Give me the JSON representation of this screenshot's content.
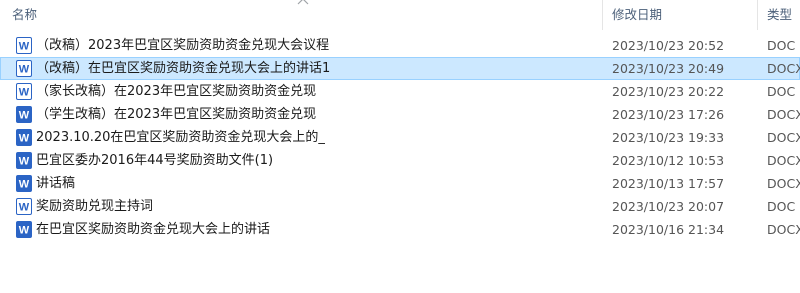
{
  "columns": {
    "name": "名称",
    "date_modified": "修改日期",
    "type": "类型"
  },
  "sort_icon": "chevron-up-icon",
  "colors": {
    "selected_row_bg": "#cce8ff",
    "selected_row_border": "#99d1ff",
    "word_blue": "#2b64c5",
    "header_text": "#4c607a"
  },
  "files": [
    {
      "name": " （改稿）2023年巴宜区奖励资助资金兑现大会议程",
      "date": "2023/10/23 20:52",
      "type": "DOC",
      "icon": "word-doc-icon",
      "selected": false
    },
    {
      "name": " （改稿）在巴宜区奖励资助资金兑现大会上的讲话1",
      "date": "2023/10/23 20:49",
      "type": "DOCX",
      "icon": "word-doc-icon",
      "selected": true
    },
    {
      "name": " （家长改稿）在2023年巴宜区奖励资助资金兑现",
      "date": "2023/10/23 20:22",
      "type": "DOC",
      "icon": "word-doc-icon",
      "selected": false
    },
    {
      "name": " （学生改稿）在2023年巴宜区奖励资助资金兑现",
      "date": "2023/10/23 17:26",
      "type": "DOCX",
      "icon": "word-docx-icon",
      "selected": false
    },
    {
      "name": "2023.10.20在巴宜区奖励资助资金兑现大会上的_",
      "date": "2023/10/23 19:33",
      "type": "DOCX",
      "icon": "word-docx-icon",
      "selected": false
    },
    {
      "name": "巴宜区委办2016年44号奖励资助文件(1)",
      "date": "2023/10/12 10:53",
      "type": "DOCX",
      "icon": "word-docx-icon",
      "selected": false
    },
    {
      "name": "讲话稿",
      "date": "2023/10/13 17:57",
      "type": "DOCX",
      "icon": "word-docx-icon",
      "selected": false
    },
    {
      "name": "奖励资助兑现主持词",
      "date": "2023/10/23 20:07",
      "type": "DOC",
      "icon": "word-doc-icon",
      "selected": false
    },
    {
      "name": "在巴宜区奖励资助资金兑现大会上的讲话",
      "date": "2023/10/16 21:34",
      "type": "DOCX",
      "icon": "word-docx-icon",
      "selected": false
    }
  ]
}
